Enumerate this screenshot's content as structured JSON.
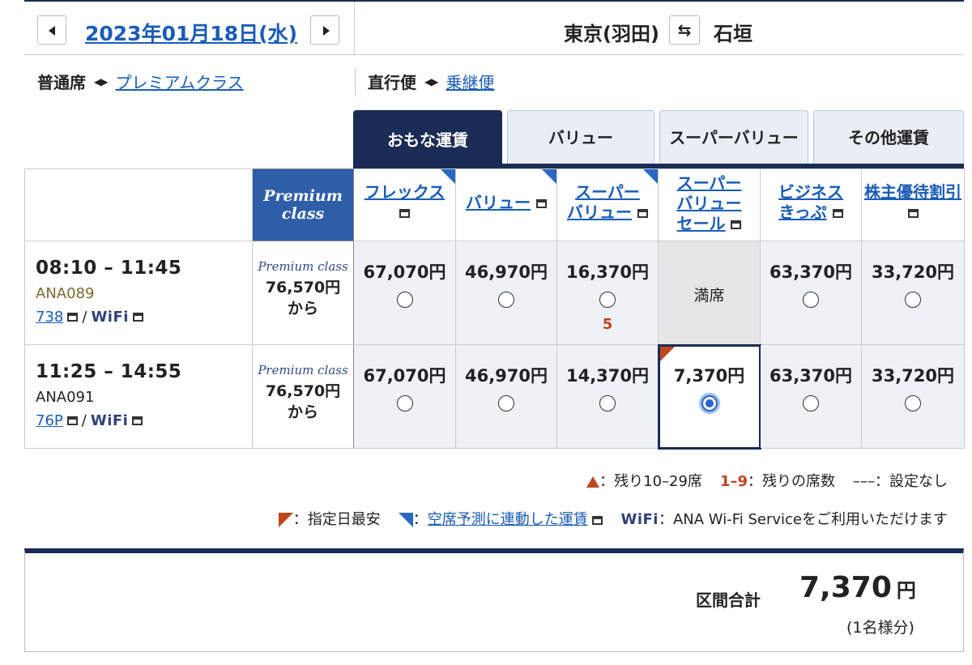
{
  "header": {
    "date": "2023年01月18日(水)",
    "from": "東京(羽田)",
    "swap_icon": "swap-arrows-icon",
    "to": "石垣"
  },
  "toggles": {
    "class_current": "普通席",
    "class_alt": "プレミアムクラス",
    "direct_current": "直行便",
    "direct_alt": "乗継便"
  },
  "tabs": [
    "おもな運賃",
    "バリュー",
    "スーパーバリュー",
    "その他運賃"
  ],
  "premium_header": "Premium class",
  "fare_headers": [
    {
      "line1": "フレックス",
      "line2": ""
    },
    {
      "line1": "バリュー",
      "line2": ""
    },
    {
      "line1": "スーパー",
      "line2": "バリュー"
    },
    {
      "line1": "スーパー",
      "line2": "バリュー",
      "line3": "セール"
    },
    {
      "line1": "ビジネス",
      "line2": "きっぷ"
    },
    {
      "line1": "株主優待割引",
      "line2": ""
    }
  ],
  "flights": [
    {
      "times": "08:10 – 11:45",
      "flight_no": "ANA089",
      "aircraft": "738",
      "wifi": "WiFi",
      "premium_label": "Premium class",
      "premium_price": "76,570円",
      "premium_from": "から",
      "fares": [
        {
          "price": "67,070円",
          "seats": ""
        },
        {
          "price": "46,970円",
          "seats": ""
        },
        {
          "price": "16,370円",
          "seats": "5"
        },
        {
          "price": "満席",
          "seats": ""
        },
        {
          "price": "63,370円",
          "seats": ""
        },
        {
          "price": "33,720円",
          "seats": ""
        }
      ]
    },
    {
      "times": "11:25 – 14:55",
      "flight_no": "ANA091",
      "aircraft": "76P",
      "wifi": "WiFi",
      "premium_label": "Premium class",
      "premium_price": "76,570円",
      "premium_from": "から",
      "fares": [
        {
          "price": "67,070円",
          "seats": ""
        },
        {
          "price": "46,970円",
          "seats": ""
        },
        {
          "price": "14,370円",
          "seats": ""
        },
        {
          "price": "7,370円",
          "seats": ""
        },
        {
          "price": "63,370円",
          "seats": ""
        },
        {
          "price": "33,720円",
          "seats": ""
        }
      ]
    }
  ],
  "legend": {
    "remaining_1029": "：残り10–29席",
    "range_19": "1–9",
    "remaining_seats": "：残りの席数",
    "not_set_dash": "–––",
    "not_set": "：設定なし",
    "lowest": "：指定日最安",
    "linked_fare": "空席予測に連動した運賃",
    "wifi_label": "WiFi",
    "wifi_service": "：ANA Wi-Fi Serviceをご利用いただけます"
  },
  "total": {
    "label": "区間合計",
    "amount": "7,370",
    "yen": "円",
    "pax": "(1名様分)"
  }
}
